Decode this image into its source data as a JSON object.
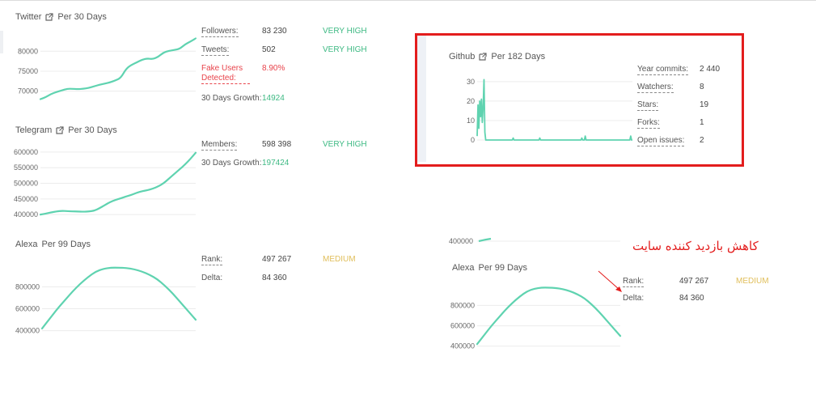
{
  "twitter": {
    "title": "Twitter",
    "period": "Per 30 Days",
    "stats": [
      {
        "label": "Followers:",
        "value": "83 230",
        "badge": "VERY HIGH"
      },
      {
        "label": "Tweets:",
        "value": "502",
        "badge": "VERY HIGH"
      },
      {
        "label": "Fake Users Detected:",
        "value": "8.90%"
      },
      {
        "label": "30 Days Growth:",
        "value": "14924"
      }
    ],
    "chart_data": {
      "type": "line",
      "yticks": [
        "80000",
        "75000",
        "70000"
      ],
      "ylim": [
        67500,
        83500
      ],
      "y": [
        68000,
        68500,
        69300,
        69800,
        70200,
        70600,
        70600,
        70500,
        70600,
        70800,
        71200,
        71600,
        71900,
        72200,
        72700,
        73300,
        75600,
        76600,
        77200,
        77900,
        78200,
        78000,
        78600,
        79700,
        80100,
        80300,
        80600,
        81700,
        82400,
        83200
      ],
      "color": "#5fd3b0"
    }
  },
  "telegram": {
    "title": "Telegram",
    "period": "Per 30 Days",
    "stats": [
      {
        "label": "Members:",
        "value": "598 398",
        "badge": "VERY HIGH"
      },
      {
        "label": "30 Days Growth:",
        "value": "197424"
      }
    ],
    "chart_data": {
      "type": "line",
      "yticks": [
        "600000",
        "550000",
        "500000",
        "450000",
        "400000"
      ],
      "ylim": [
        390000,
        605000
      ],
      "y": [
        400000,
        403000,
        407000,
        410000,
        412000,
        411000,
        410000,
        410000,
        409000,
        410000,
        412000,
        420000,
        430000,
        440000,
        447000,
        452000,
        458000,
        463000,
        470000,
        475000,
        478000,
        483000,
        490000,
        500000,
        515000,
        530000,
        545000,
        560000,
        578000,
        598000
      ],
      "color": "#5fd3b0"
    }
  },
  "alexa": {
    "title": "Alexa",
    "period": "Per 99 Days",
    "stats": [
      {
        "label": "Rank:",
        "value": "497 267",
        "badge": "MEDIUM"
      },
      {
        "label": "Delta:",
        "value": "84 360"
      }
    ],
    "chart_data": {
      "type": "line",
      "yticks": [
        "800000",
        "600000",
        "400000"
      ],
      "ylim": [
        390000,
        1010000
      ],
      "y": [
        420000,
        510000,
        600000,
        680000,
        760000,
        830000,
        890000,
        940000,
        965000,
        975000,
        975000,
        972000,
        960000,
        940000,
        910000,
        870000,
        810000,
        740000,
        660000,
        580000,
        500000
      ],
      "color": "#5fd3b0"
    }
  },
  "github": {
    "title": "Github",
    "period": "Per 182 Days",
    "stats": [
      {
        "label": "Year commits:",
        "value": "2 440"
      },
      {
        "label": "Watchers:",
        "value": "8"
      },
      {
        "label": "Stars:",
        "value": "19"
      },
      {
        "label": "Forks:",
        "value": "1"
      },
      {
        "label": "Open issues:",
        "value": "2"
      }
    ],
    "chart_data": {
      "type": "line",
      "yticks": [
        "30",
        "20",
        "10",
        "0"
      ],
      "ylim": [
        0,
        32
      ],
      "spikes": [
        [
          0,
          2
        ],
        [
          1,
          18
        ],
        [
          2,
          6
        ],
        [
          3,
          20
        ],
        [
          4,
          12
        ],
        [
          5,
          21
        ],
        [
          6,
          9
        ],
        [
          7,
          17
        ],
        [
          8,
          31
        ],
        [
          9,
          4
        ],
        [
          10,
          0
        ],
        [
          41,
          0
        ],
        [
          42,
          1
        ],
        [
          43,
          0
        ],
        [
          72,
          0
        ],
        [
          73,
          1
        ],
        [
          74,
          0
        ],
        [
          121,
          0
        ],
        [
          122,
          1
        ],
        [
          123,
          0
        ],
        [
          125,
          0
        ],
        [
          126,
          2
        ],
        [
          127,
          0
        ],
        [
          178,
          0
        ],
        [
          179,
          2
        ],
        [
          180,
          0
        ],
        [
          181,
          0
        ]
      ],
      "xmax": 181,
      "color": "#5fd3b0"
    }
  },
  "alexa_copy": {
    "title": "Alexa",
    "period": "Per 99 Days",
    "cut_tick": "400000",
    "stats": [
      {
        "label": "Rank:",
        "value": "497 267",
        "badge": "MEDIUM"
      },
      {
        "label": "Delta:",
        "value": "84 360"
      }
    ],
    "chart_data": {
      "type": "line",
      "yticks": [
        "800000",
        "600000",
        "400000"
      ],
      "ylim": [
        390000,
        1010000
      ],
      "y": [
        420000,
        510000,
        600000,
        680000,
        760000,
        830000,
        890000,
        940000,
        965000,
        975000,
        975000,
        972000,
        960000,
        940000,
        910000,
        870000,
        810000,
        740000,
        660000,
        580000,
        500000
      ],
      "color": "#5fd3b0"
    }
  },
  "annotation": {
    "text": "کاهش بازدید کننده سایت",
    "color": "#e31d1d"
  }
}
